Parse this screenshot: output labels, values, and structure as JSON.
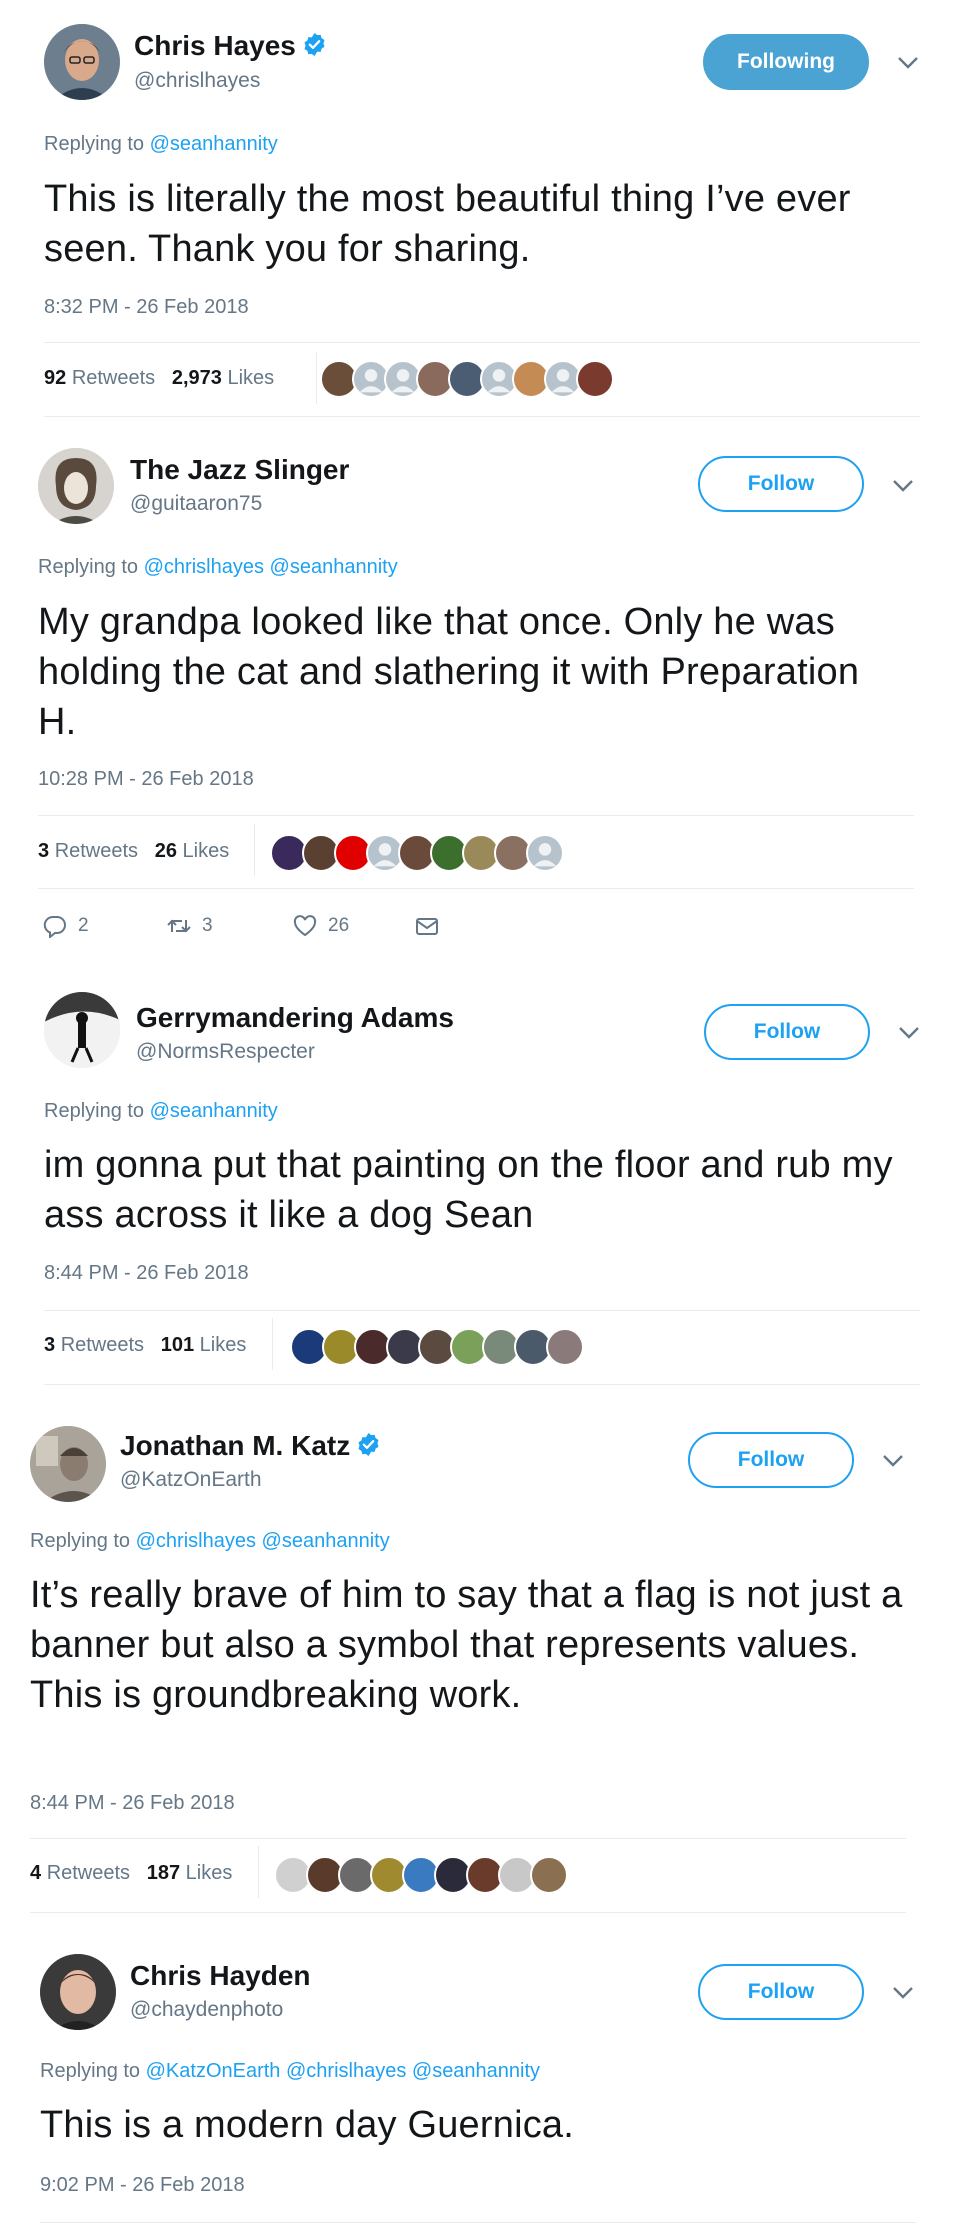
{
  "tweets": [
    {
      "name": "Chris Hayes",
      "verified": true,
      "handle": "@chrislhayes",
      "button": "Following",
      "reply_prefix": "Replying to",
      "reply_to": "@seanhannity",
      "text": "This is literally the most beautiful thing I’ve ever seen. Thank you for sharing.",
      "timestamp": "8:32 PM - 26 Feb 2018",
      "retweets_count": "92",
      "retweets_label": "Retweets",
      "likes_count": "2,973",
      "likes_label": "Likes",
      "liker_colors": [
        "#6b4e3a",
        "#b7c3cc",
        "#b7c3cc",
        "#8a6a5c",
        "#4b5d73",
        "#b7c3cc",
        "#c48b55",
        "#b7c3cc",
        "#7a3b2e"
      ]
    },
    {
      "name": "The Jazz Slinger",
      "verified": false,
      "handle": "@guitaaron75",
      "button": "Follow",
      "reply_prefix": "Replying to",
      "reply_to": "@chrislhayes @seanhannity",
      "text": "My grandpa looked like that once. Only he was holding the cat and slathering it with Preparation H.",
      "timestamp": "10:28 PM - 26 Feb 2018",
      "retweets_count": "3",
      "retweets_label": "Retweets",
      "likes_count": "26",
      "likes_label": "Likes",
      "liker_colors": [
        "#3a2a5c",
        "#5a4030",
        "#e00000",
        "#b7c3cc",
        "#6a4a3a",
        "#3c6e2e",
        "#9a8a5a",
        "#8a7060",
        "#b7c3cc"
      ],
      "actions": {
        "replies": "2",
        "retweets": "3",
        "likes": "26"
      }
    },
    {
      "name": "Gerrymandering Adams",
      "verified": false,
      "handle": "@NormsRespecter",
      "button": "Follow",
      "reply_prefix": "Replying to",
      "reply_to": "@seanhannity",
      "text": "im gonna put that painting on the floor and rub my ass across it like a dog Sean",
      "timestamp": "8:44 PM - 26 Feb 2018",
      "retweets_count": "3",
      "retweets_label": "Retweets",
      "likes_count": "101",
      "likes_label": "Likes",
      "liker_colors": [
        "#1a3a7a",
        "#9a8a2a",
        "#4a2a2a",
        "#3a3a4a",
        "#5a4a40",
        "#7aa05a",
        "#7a8a7a",
        "#4a5a6a",
        "#8a7a7a"
      ]
    },
    {
      "name": "Jonathan M. Katz",
      "verified": true,
      "handle": "@KatzOnEarth",
      "button": "Follow",
      "reply_prefix": "Replying to",
      "reply_to": "@chrislhayes @seanhannity",
      "text": "It’s really brave of him to say that a flag is not just a banner but also a symbol that represents values. This is groundbreaking work.",
      "timestamp": "8:44 PM - 26 Feb 2018",
      "retweets_count": "4",
      "retweets_label": "Retweets",
      "likes_count": "187",
      "likes_label": "Likes",
      "liker_colors": [
        "#d0d0d0",
        "#5a3a2a",
        "#6a6a6a",
        "#a08a30",
        "#3a7ac0",
        "#2a2a3a",
        "#6a3a2a",
        "#c8c8c8",
        "#8a7050"
      ]
    },
    {
      "name": "Chris Hayden",
      "verified": false,
      "handle": "@chaydenphoto",
      "button": "Follow",
      "reply_prefix": "Replying to",
      "reply_to": "@KatzOnEarth @chrislhayes @seanhannity",
      "text": "This is a modern day Guernica.",
      "timestamp": "9:02 PM - 26 Feb 2018"
    }
  ],
  "colors": {
    "accent": "#1da1f2",
    "muted": "#657786",
    "divider": "#e6ecf0",
    "following_bg": "#4aa3d3"
  },
  "icons": [
    "verified-badge-icon",
    "chevron-down-icon",
    "reply-icon",
    "retweet-icon",
    "like-icon",
    "message-icon"
  ]
}
